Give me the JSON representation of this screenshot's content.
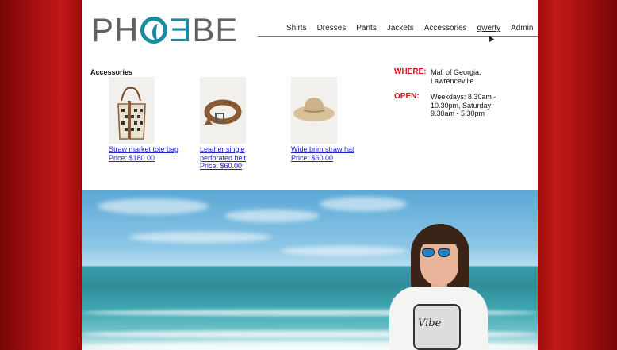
{
  "brand": {
    "logo_text": "PHOEBE"
  },
  "nav": {
    "items": [
      "Shirts",
      "Dresses",
      "Pants",
      "Jackets",
      "Accessories",
      "qwerty",
      "Admin"
    ],
    "active_index": 5
  },
  "section": {
    "title": "Accessories"
  },
  "products": [
    {
      "name": "Straw market tote bag",
      "price": "Price: $180.00",
      "image_icon": "tote-bag-image"
    },
    {
      "name": "Leather single perforated belt",
      "price": "Price: $60.00",
      "image_icon": "belt-image"
    },
    {
      "name": "Wide brim straw hat",
      "price": "Price: $60.00",
      "image_icon": "hat-image"
    }
  ],
  "info": {
    "where_label": "WHERE:",
    "where_value": "Mall of Georgia, Lawrenceville",
    "open_label": "OPEN:",
    "open_value": "Weekdays: 8.30am - 10.30pm, Saturday: 9.30am - 5.30pm"
  },
  "hero": {
    "shirt_text": "Vibe"
  },
  "colors": {
    "accent": "#1a8aa0",
    "label_red": "#d0121a",
    "link": "#1a24c8",
    "frame": "#8e0808"
  }
}
